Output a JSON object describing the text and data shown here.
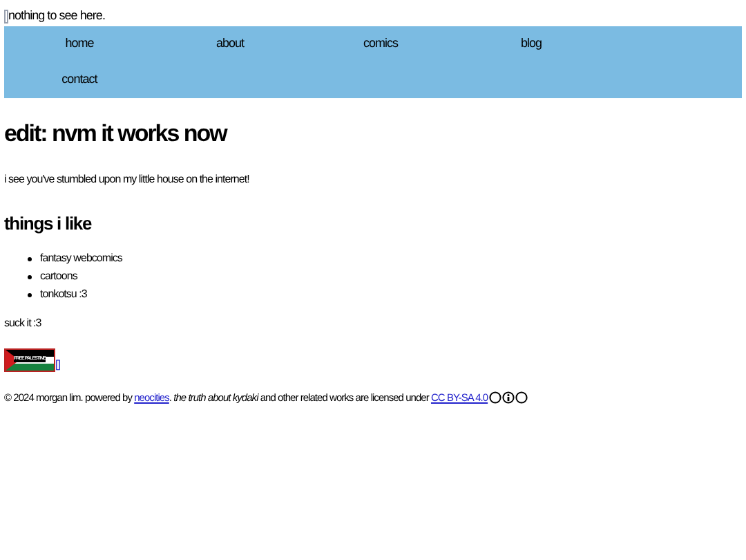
{
  "broken_image": {
    "alt": "nothing to see here."
  },
  "nav": [
    {
      "label": "home"
    },
    {
      "label": "about"
    },
    {
      "label": "comics"
    },
    {
      "label": "blog"
    },
    {
      "label": "contact"
    }
  ],
  "heading": "edit: nvm it works now",
  "intro": "i see you've stumbled upon my little house on the internet!",
  "likes_heading": "things i like",
  "likes": [
    "fantasy webcomics",
    "cartoons",
    "tonkotsu :3"
  ],
  "outro": "suck it :3",
  "banner": {
    "text": "FREE PALESTINE",
    "link": "[]"
  },
  "footer": {
    "before": "© 2024 morgan lim. powered by ",
    "link": "neocities",
    "middle": ". *the truth about kydaki* and other related works are licensed under ",
    "license": "CC BY-SA 4.0"
  }
}
